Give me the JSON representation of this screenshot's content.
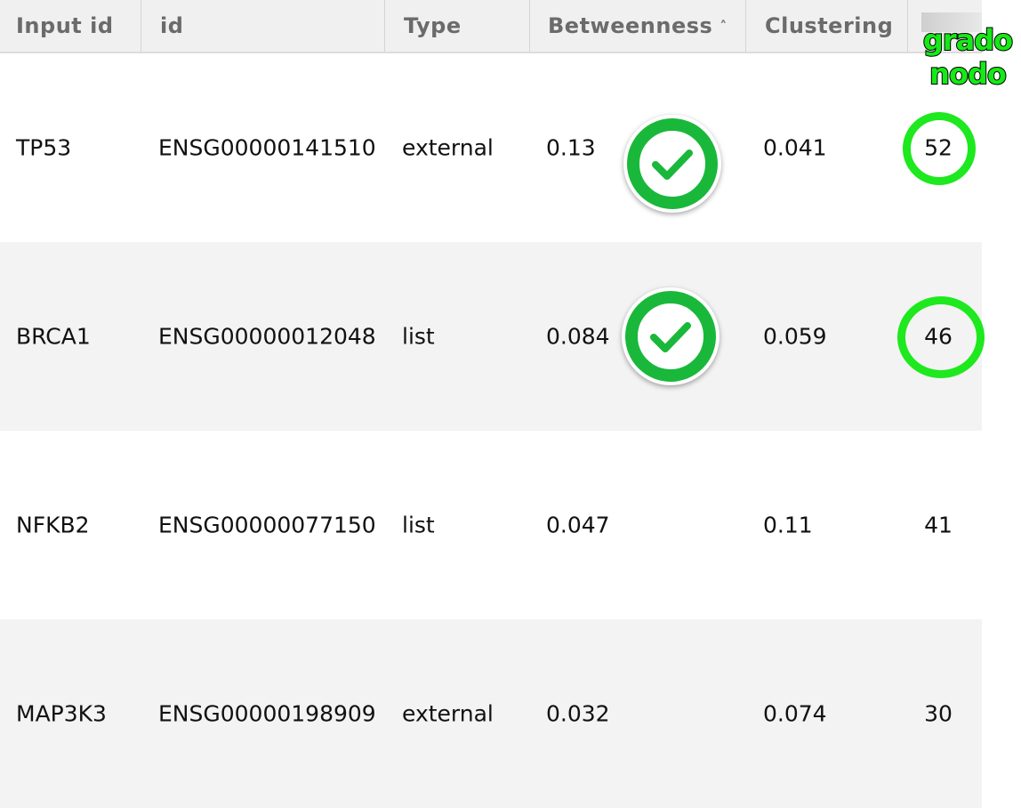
{
  "colors": {
    "header_bg": "#f0f0f0",
    "header_text": "#6b6b6b",
    "row_alt_bg": "#f3f3f3",
    "annotation_green": "#1ee81e",
    "check_green": "#1ab83a"
  },
  "table": {
    "columns": [
      {
        "label": "Input id"
      },
      {
        "label": "id"
      },
      {
        "label": "Type"
      },
      {
        "label": "Betweenness",
        "sort": "ascending",
        "sort_icon": "chevron-up-icon"
      },
      {
        "label": "Clustering"
      }
    ],
    "rows": [
      {
        "input_id": "TP53",
        "id": "ENSG00000141510",
        "type": "external",
        "betweenness": "0.13",
        "clustering": "0.041",
        "degree": "52"
      },
      {
        "input_id": "BRCA1",
        "id": "ENSG00000012048",
        "type": "list",
        "betweenness": "0.084",
        "clustering": "0.059",
        "degree": "46"
      },
      {
        "input_id": "NFKB2",
        "id": "ENSG00000077150",
        "type": "list",
        "betweenness": "0.047",
        "clustering": "0.11",
        "degree": "41"
      },
      {
        "input_id": "MAP3K3",
        "id": "ENSG00000198909",
        "type": "external",
        "betweenness": "0.032",
        "clustering": "0.074",
        "degree": "30"
      }
    ]
  },
  "annotations": {
    "label_line1": "grado",
    "label_line2": "nodo",
    "check_icon": "check-circle-icon",
    "checked_rows": [
      "TP53",
      "BRCA1"
    ],
    "circled_degrees": [
      "52",
      "46"
    ]
  }
}
